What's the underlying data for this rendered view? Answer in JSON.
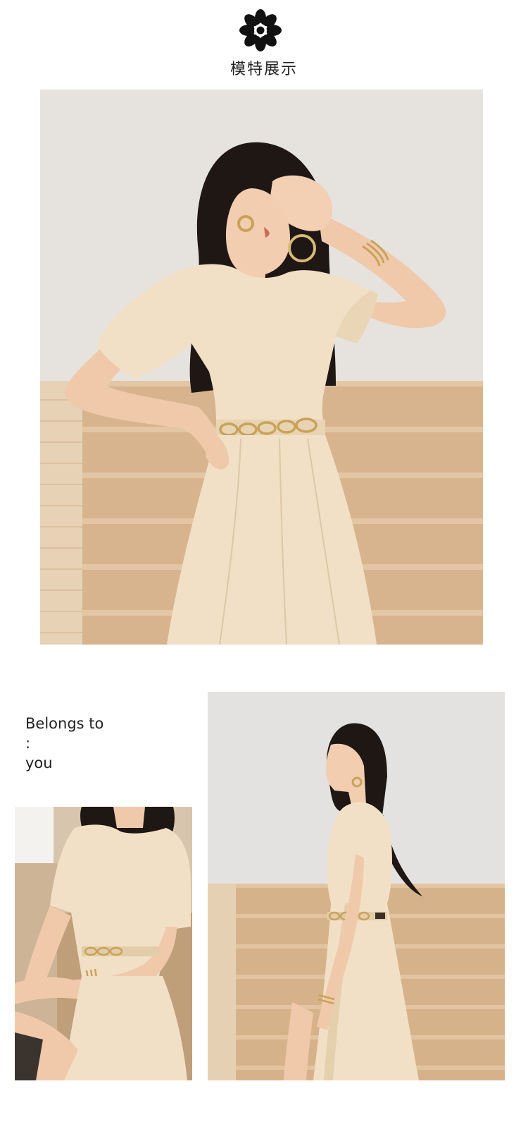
{
  "header": {
    "icon": "flower-icon",
    "title": "模特展示"
  },
  "tagline": {
    "line1": "Belongs to",
    "line2": ":",
    "line3": "you"
  },
  "photos": {
    "main": "model-photo-front",
    "side": "model-photo-side",
    "small": "model-photo-closeup"
  },
  "colors": {
    "background": "#ffffff",
    "wall": "#e6e3df",
    "stairs": "#d9b58f",
    "dress": "#f1e0c6",
    "hair": "#1e1714",
    "skin": "#f0c9ab",
    "gold": "#c9a25a"
  }
}
